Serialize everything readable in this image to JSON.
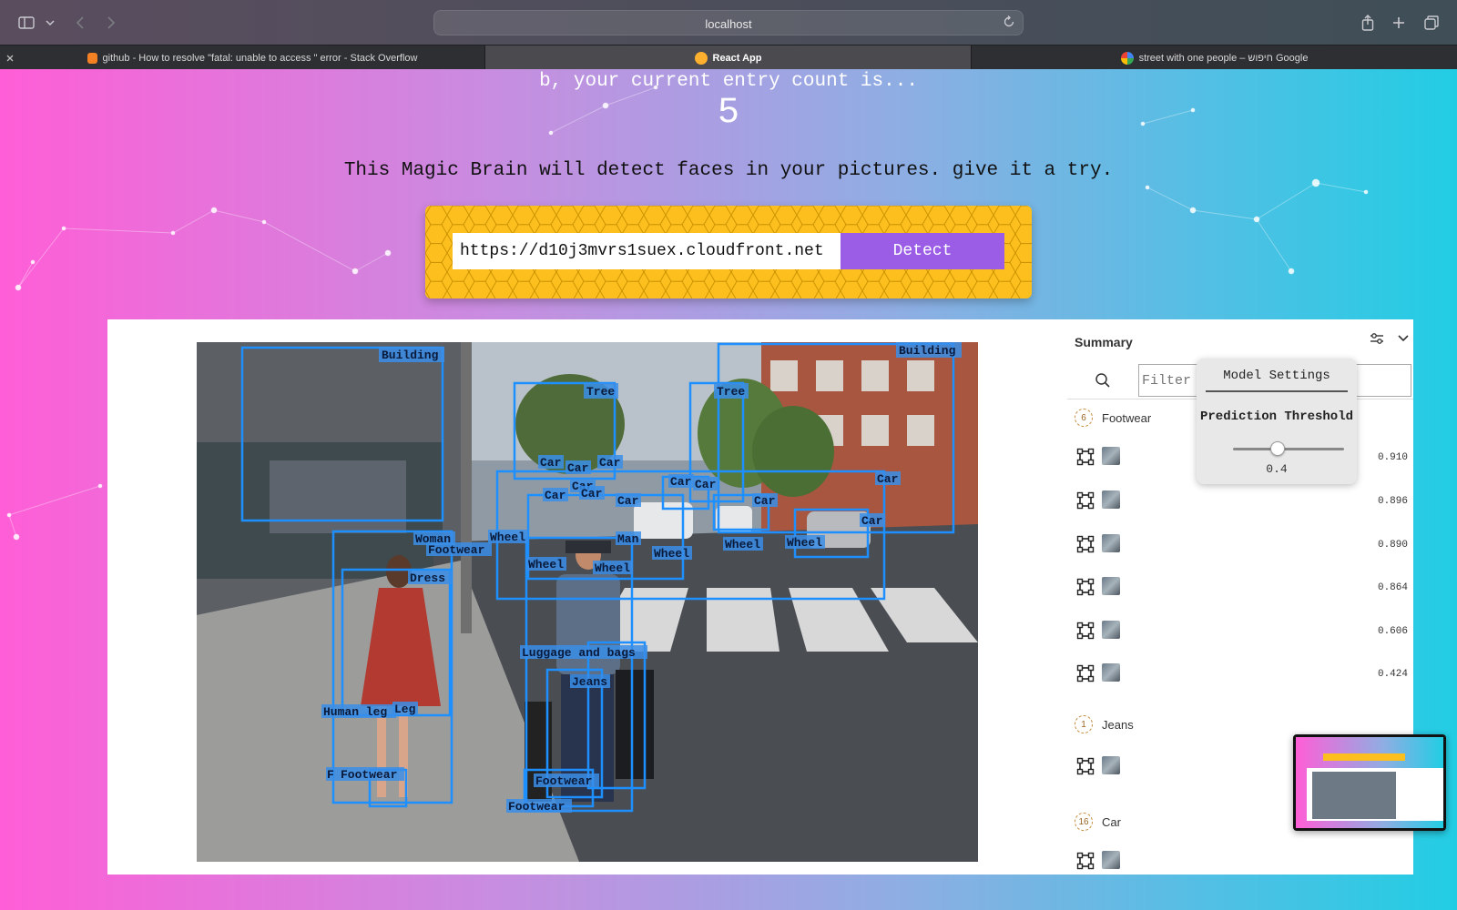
{
  "browser": {
    "url": "localhost",
    "tabs": [
      {
        "label": "github - How to resolve \"fatal: unable to access \" error - Stack Overflow",
        "active": false
      },
      {
        "label": "React App",
        "active": true
      },
      {
        "label": "street with one people – חיפוש Google",
        "active": false
      }
    ]
  },
  "header": {
    "greeting": "b, your current entry count is...",
    "entry_count": "5",
    "tagline": "This Magic Brain will detect faces in your pictures. give it a try."
  },
  "form": {
    "url_value": "https://d10j3mvrs1suex.cloudfront.net",
    "detect_label": "Detect"
  },
  "detections": [
    {
      "label": "Building"
    },
    {
      "label": "Building"
    },
    {
      "label": "Tree"
    },
    {
      "label": "Tree"
    },
    {
      "label": "Car"
    },
    {
      "label": "Car"
    },
    {
      "label": "Car"
    },
    {
      "label": "Car"
    },
    {
      "label": "Car"
    },
    {
      "label": "Car"
    },
    {
      "label": "Car"
    },
    {
      "label": "Car"
    },
    {
      "label": "Car"
    },
    {
      "label": "Car"
    },
    {
      "label": "Car"
    },
    {
      "label": "Car"
    },
    {
      "label": "Woman"
    },
    {
      "label": "Footwear"
    },
    {
      "label": "Dress"
    },
    {
      "label": "Man"
    },
    {
      "label": "Wheel"
    },
    {
      "label": "Wheel"
    },
    {
      "label": "Wheel"
    },
    {
      "label": "Wheel"
    },
    {
      "label": "Wheel"
    },
    {
      "label": "Wheel"
    },
    {
      "label": "Luggage and bags"
    },
    {
      "label": "Jeans"
    },
    {
      "label": "Human leg"
    },
    {
      "label": "Leg"
    },
    {
      "label": "Footwear"
    },
    {
      "label": "Footwear"
    },
    {
      "label": "Footwear"
    },
    {
      "label": "F"
    }
  ],
  "summary": {
    "title": "Summary",
    "filter_placeholder": "Filter",
    "categories": [
      {
        "count": "6",
        "name": "Footwear",
        "scores": [
          "0.910",
          "0.896",
          "0.890",
          "0.864",
          "0.606",
          "0.424"
        ]
      },
      {
        "count": "1",
        "name": "Jeans",
        "scores": [
          ""
        ]
      },
      {
        "count": "16",
        "name": "Car",
        "scores": [
          ""
        ]
      }
    ]
  },
  "model_settings": {
    "title": "Model Settings",
    "label": "Prediction Threshold",
    "threshold": 0.4,
    "threshold_text": "0.4"
  },
  "colors": {
    "box": "#1e8fff",
    "label_bg": "#3a8ee8",
    "panel": "#fcbf1e",
    "button": "#9b5de5"
  }
}
